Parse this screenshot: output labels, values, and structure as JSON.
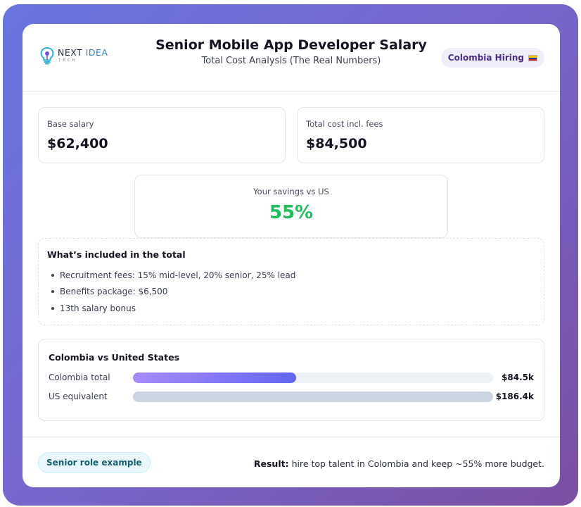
{
  "header": {
    "logo": {
      "word1": "NEXT",
      "word2": "IDEA",
      "sub": "TECH"
    },
    "title": "Senior Mobile App Developer Salary",
    "subtitle": "Total Cost Analysis (The Real Numbers)",
    "hiring_badge": "Colombia Hiring",
    "flag_icon": "colombia-flag-icon"
  },
  "stats": {
    "base": {
      "label": "Base salary",
      "value": "$62,400"
    },
    "total": {
      "label": "Total cost incl. fees",
      "value": "$84,500"
    },
    "savings": {
      "label": "Your savings vs US",
      "value": "55%"
    }
  },
  "included": {
    "title": "What’s included in the total",
    "items": [
      "Recruitment fees: 15% mid-level, 20% senior, 25% lead",
      "Benefits package: $6,500",
      "13th salary bonus"
    ]
  },
  "comparison": {
    "title": "Colombia vs United States",
    "bars": [
      {
        "label": "Colombia total",
        "value": 84.5,
        "display": "$84.5k",
        "color_start": "#a78bfa",
        "color_end": "#6366f1"
      },
      {
        "label": "US equivalent",
        "value": 186.4,
        "display": "$186.4k",
        "color_start": "#cbd5e1",
        "color_end": "#cbd5e1"
      }
    ],
    "max": 186.4
  },
  "footer": {
    "role_badge": "Senior role example",
    "result_label": "Result:",
    "result_text": " hire top talent in Colombia and keep ~55% more budget."
  },
  "colors": {
    "savings_green": "#1fbf5c",
    "accent_purple": "#6366f1",
    "background_gradient_start": "#6a74e0",
    "background_gradient_end": "#7a4fa3"
  }
}
